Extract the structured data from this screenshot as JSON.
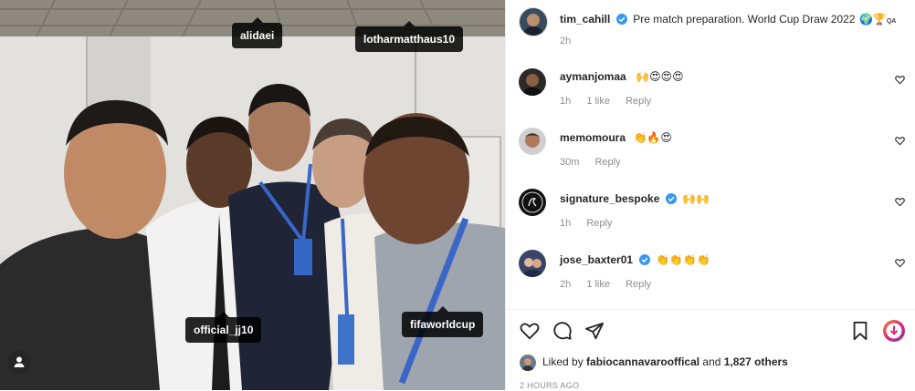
{
  "photo": {
    "tags": [
      "alidaei",
      "lotharmatthaus10",
      "official_jj10",
      "fifaworldcup"
    ]
  },
  "post": {
    "author": "tim_cahill",
    "caption": "Pre match preparation. World Cup Draw 2022",
    "caption_emoji": "🌍🏆",
    "caption_flag": "QA",
    "time": "2h"
  },
  "comments": [
    {
      "user": "aymanjomaa",
      "verified": false,
      "text": "🙌😍😍😍",
      "time": "1h",
      "likes": "1 like",
      "reply": "Reply"
    },
    {
      "user": "memomoura",
      "verified": false,
      "text": "👏🔥😍",
      "time": "30m",
      "likes": "",
      "reply": "Reply"
    },
    {
      "user": "signature_bespoke",
      "verified": true,
      "text": "🙌🙌",
      "time": "1h",
      "likes": "",
      "reply": "Reply"
    },
    {
      "user": "jose_baxter01",
      "verified": true,
      "text": "👏👏👏👏",
      "time": "2h",
      "likes": "1 like",
      "reply": "Reply"
    }
  ],
  "likes": {
    "prefix": "Liked by",
    "user": "fabiocannavarooffical",
    "suffix": "and",
    "others": "1,827 others"
  },
  "timestamp": "2 HOURS AGO",
  "colors": {
    "verified": "#3897f0",
    "tag_bg": "#000000",
    "muted": "#8e8e8e",
    "save_accent": "#e1306c"
  }
}
